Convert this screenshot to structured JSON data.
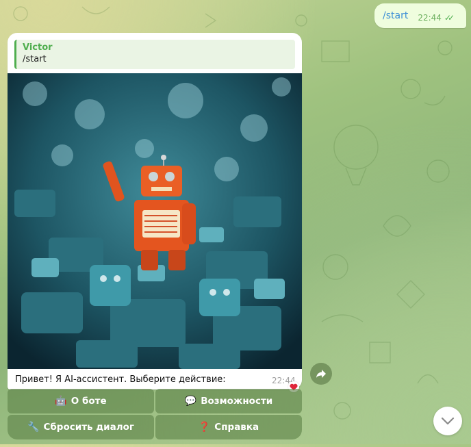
{
  "outgoing": {
    "text": "/start",
    "time": "22:44",
    "status_icon": "double-check-icon"
  },
  "incoming": {
    "reply": {
      "name": "Victor",
      "text": "/start"
    },
    "photo_icon": "robot-toys-photo",
    "caption": "Привет! Я AI-ассистент. Выберите действие:",
    "time": "22:44",
    "reaction": "heart-icon"
  },
  "keyboard": {
    "rows": [
      [
        {
          "icon": "🤖",
          "label": "О боте"
        },
        {
          "icon": "💬",
          "label": "Возможности"
        }
      ],
      [
        {
          "icon": "🔧",
          "label": "Сбросить диалог"
        },
        {
          "icon": "❓",
          "label": "Справка"
        }
      ]
    ]
  },
  "colors": {
    "accent": "#4fae4e",
    "link": "#3b8ed6",
    "bubble_out": "#effdde",
    "bubble_in": "#ffffff"
  }
}
